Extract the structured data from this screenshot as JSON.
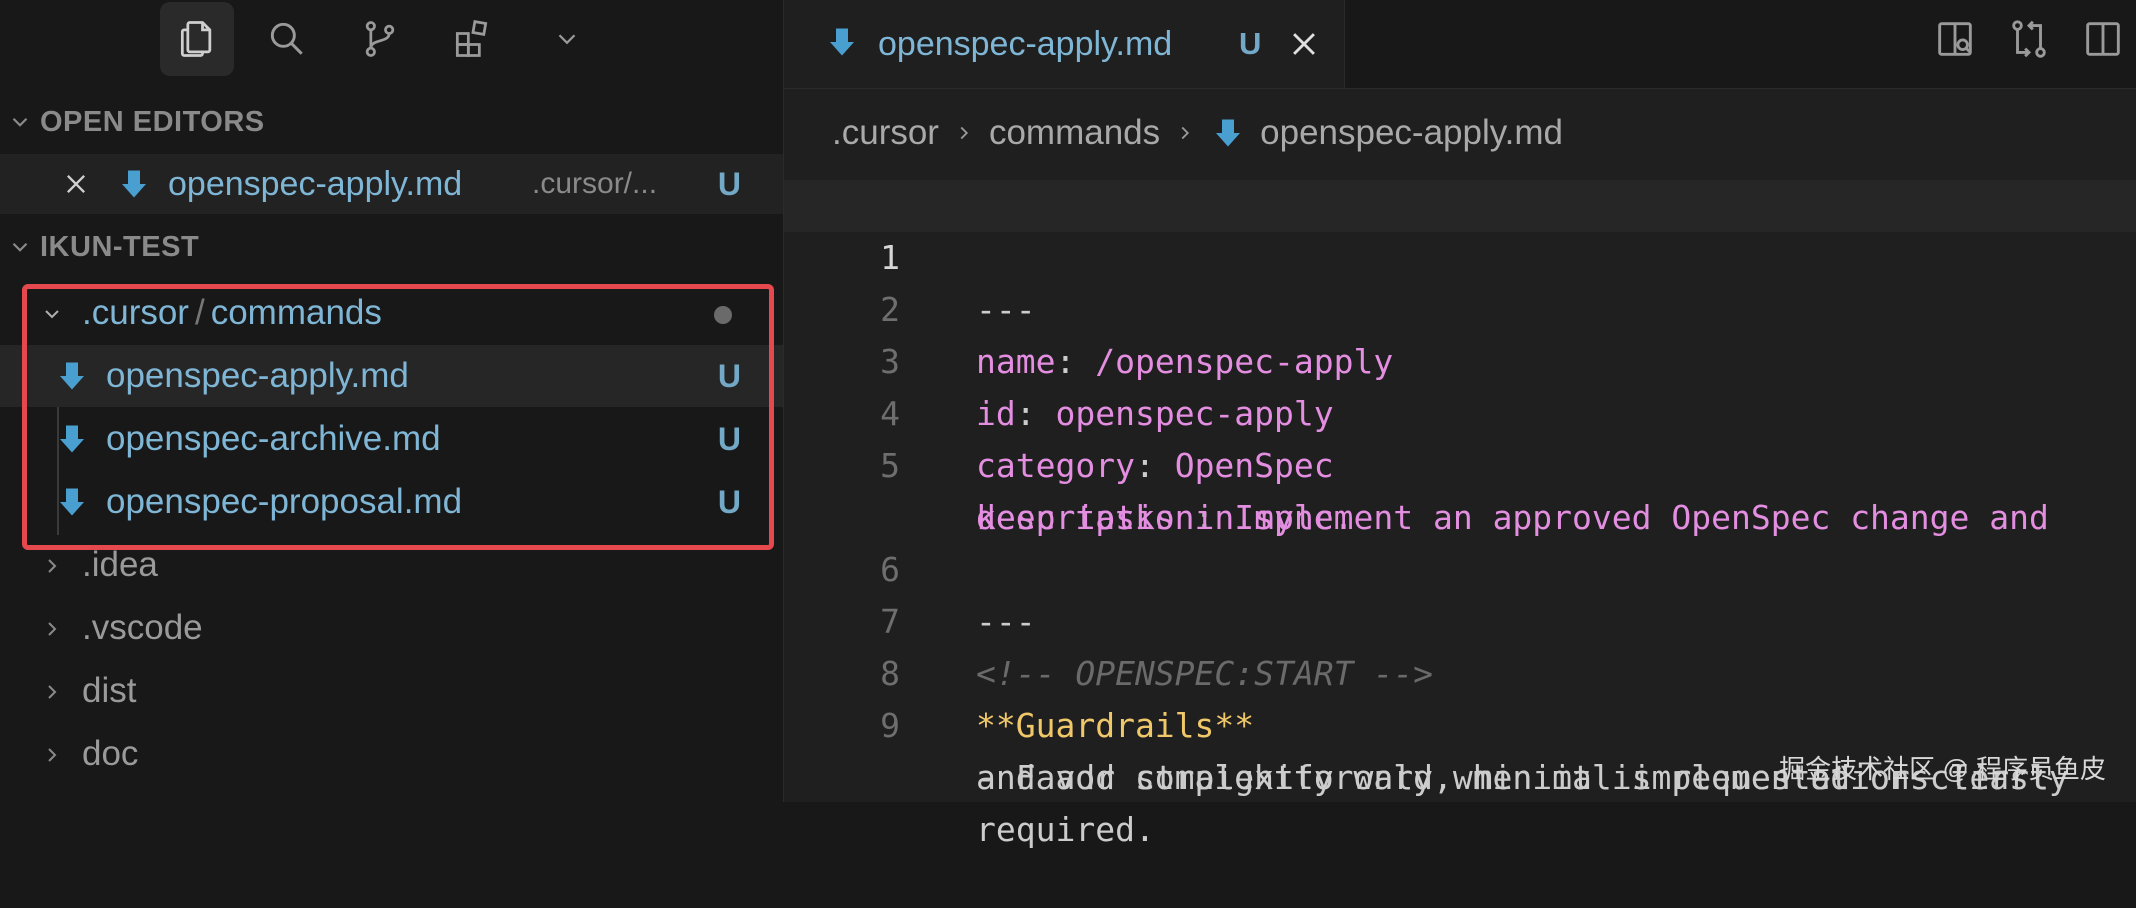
{
  "colors": {
    "sidebar_bg": "#181818",
    "editor_bg": "#1f1f1f",
    "file_name": "#7fb6d6",
    "untracked_flag": "#73a9c7",
    "highlight_border": "#e5484d",
    "yaml_key": "#e38ee0",
    "bold_text": "#f0c869"
  },
  "activity_bar": {
    "items": [
      {
        "icon": "explorer-icon",
        "active": true
      },
      {
        "icon": "search-icon"
      },
      {
        "icon": "source-control-icon"
      },
      {
        "icon": "extensions-icon"
      },
      {
        "icon": "chevron-down-icon"
      }
    ]
  },
  "open_editors": {
    "title": "OPEN EDITORS",
    "items": [
      {
        "name": "openspec-apply.md",
        "path": ".cursor/...",
        "status": "U"
      }
    ]
  },
  "workspace": {
    "title": "IKUN-TEST",
    "folders": [
      {
        "name_part1": ".cursor",
        "separator": "/",
        "name_part2": "commands",
        "expanded": true,
        "files": [
          {
            "name": "openspec-apply.md",
            "status": "U"
          },
          {
            "name": "openspec-archive.md",
            "status": "U"
          },
          {
            "name": "openspec-proposal.md",
            "status": "U"
          }
        ]
      },
      {
        "name": ".idea"
      },
      {
        "name": ".vscode"
      },
      {
        "name": "dist"
      },
      {
        "name": "doc"
      }
    ]
  },
  "editor": {
    "tab": {
      "name": "openspec-apply.md",
      "status": "U"
    },
    "breadcrumb": [
      ".cursor",
      "commands",
      "openspec-apply.md"
    ],
    "lines": [
      {
        "n": "1",
        "dash": "---"
      },
      {
        "n": "2",
        "key": "name",
        "val": " /openspec-apply"
      },
      {
        "n": "3",
        "key": "id",
        "val": " openspec-apply"
      },
      {
        "n": "4",
        "key": "category",
        "val": " OpenSpec"
      },
      {
        "n": "5",
        "key": "description",
        "val": " Implement an approved OpenSpec change and",
        "cont": "keep tasks in sync."
      },
      {
        "n": "6",
        "dash": "---"
      },
      {
        "n": "7",
        "comment": "<!-- OPENSPEC:START -->"
      },
      {
        "n": "8",
        "bold": "**Guardrails**"
      },
      {
        "n": "9",
        "text": "- Favor straightforward, minimal implementations first",
        "cont": "and add complexity only when it is requested or clearly",
        "cont2": "required."
      }
    ]
  },
  "watermark": "掘金技术社区 @ 程序员鱼皮"
}
